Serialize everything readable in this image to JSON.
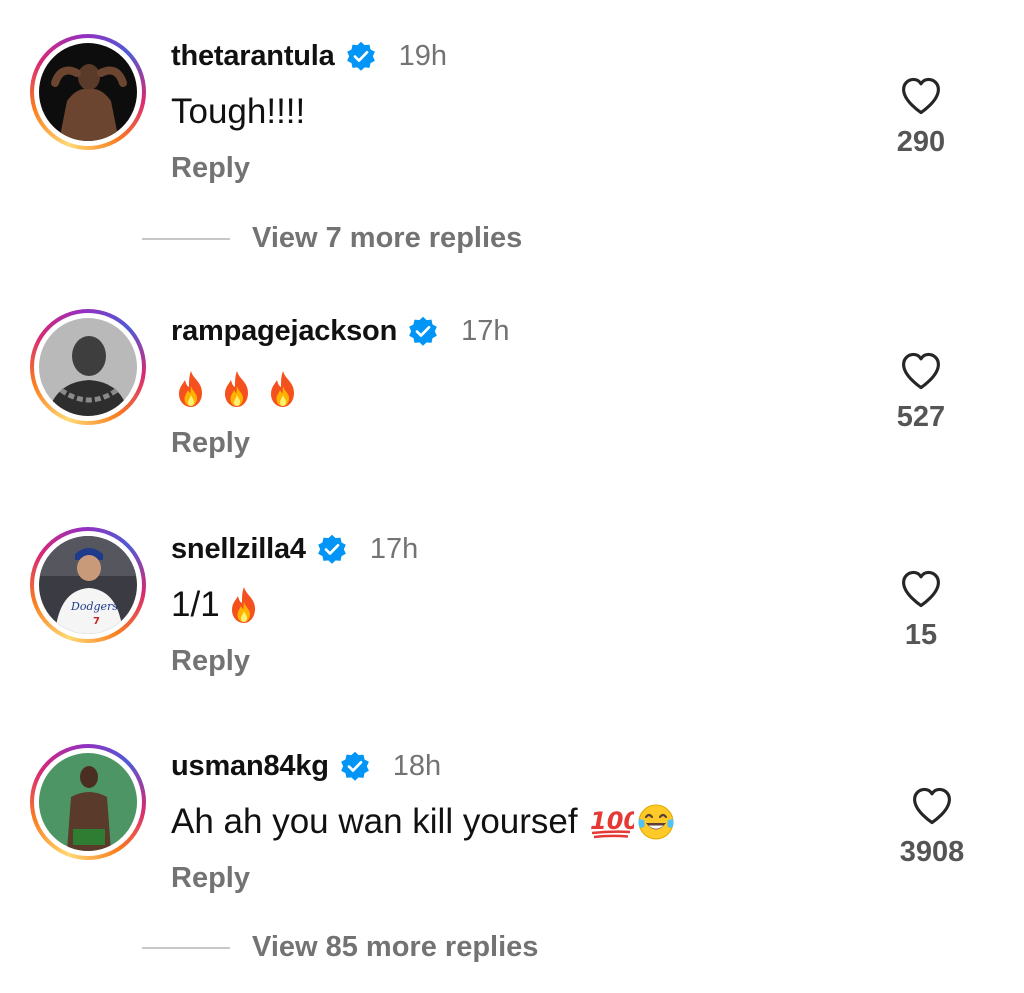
{
  "colors": {
    "verified_blue": "#0095f6",
    "muted_text": "#737373",
    "text": "#111111"
  },
  "comments": [
    {
      "username": "thetarantula",
      "verified": true,
      "time": "19h",
      "text": "Tough!!!!",
      "emojis": [],
      "reply_label": "Reply",
      "likes": "290"
    },
    {
      "username": "rampagejackson",
      "verified": true,
      "time": "17h",
      "text": "",
      "emojis": [
        "fire",
        "fire",
        "fire"
      ],
      "reply_label": "Reply",
      "likes": "527"
    },
    {
      "username": "snellzilla4",
      "verified": true,
      "time": "17h",
      "text": "1/1",
      "emojis": [
        "fire"
      ],
      "reply_label": "Reply",
      "likes": "15"
    },
    {
      "username": "usman84kg",
      "verified": true,
      "time": "18h",
      "text": "Ah ah you wan kill yoursef",
      "emojis": [
        "hundred-points",
        "face-with-tears-of-joy"
      ],
      "reply_label": "Reply",
      "likes": "3908"
    }
  ],
  "view_replies": [
    {
      "label": "View 7 more replies"
    },
    {
      "label": "View 85 more replies"
    }
  ]
}
